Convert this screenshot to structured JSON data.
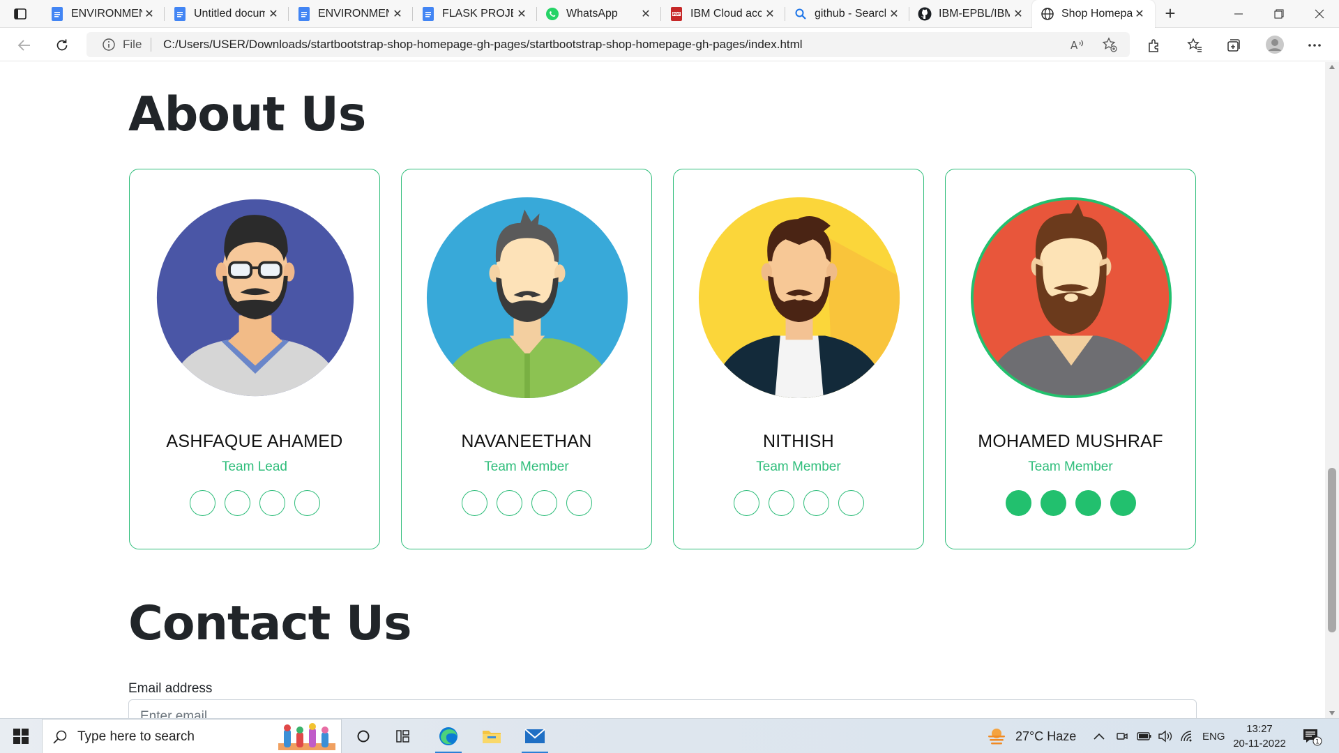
{
  "browser": {
    "tabs": [
      {
        "title": "ENVIRONMENT",
        "icon": "google-docs-icon",
        "active": false
      },
      {
        "title": "Untitled document",
        "icon": "google-docs-icon",
        "active": false
      },
      {
        "title": "ENVIRONMENT",
        "icon": "google-docs-icon",
        "active": false
      },
      {
        "title": "FLASK PROJECT",
        "icon": "google-docs-icon",
        "active": false
      },
      {
        "title": "WhatsApp",
        "icon": "whatsapp-icon",
        "active": false
      },
      {
        "title": "IBM Cloud account",
        "icon": "pdf-icon",
        "active": false
      },
      {
        "title": "github - Search",
        "icon": "search-icon",
        "active": false
      },
      {
        "title": "IBM-EPBL/IBM",
        "icon": "github-icon",
        "active": false
      },
      {
        "title": "Shop Homepage",
        "icon": "globe-icon",
        "active": true
      }
    ],
    "address": {
      "scheme_label": "File",
      "url": "C:/Users/USER/Downloads/startbootstrap-shop-homepage-gh-pages/startbootstrap-shop-homepage-gh-pages/index.html"
    }
  },
  "page": {
    "about_title": "About Us",
    "team": [
      {
        "name": "ASHFAQUE AHAMED",
        "role": "Team Lead",
        "avatar": "avatar-glasses-beard",
        "avatar_bg": "#4a56a6",
        "socials_filled": false
      },
      {
        "name": "NAVANEETHAN",
        "role": "Team Member",
        "avatar": "avatar-green-shirt",
        "avatar_bg": "#38a9d9",
        "socials_filled": false
      },
      {
        "name": "NITHISH",
        "role": "Team Member",
        "avatar": "avatar-dark-jacket",
        "avatar_bg": "#fbd63a",
        "socials_filled": false
      },
      {
        "name": "MOHAMED MUSHRAF",
        "role": "Team Member",
        "avatar": "avatar-red-bearded",
        "avatar_bg": "#e8563b",
        "socials_filled": true
      }
    ],
    "contact_title": "Contact Us",
    "email_label": "Email address",
    "email_placeholder": "Enter email"
  },
  "colors": {
    "accent": "#2ebd7a",
    "accent_filled": "#22c06e",
    "heading": "#212529"
  },
  "taskbar": {
    "search_placeholder": "Type here to search",
    "weather": "27°C  Haze",
    "language": "ENG",
    "time": "13:27",
    "date": "20-11-2022",
    "notification_count": "1"
  }
}
